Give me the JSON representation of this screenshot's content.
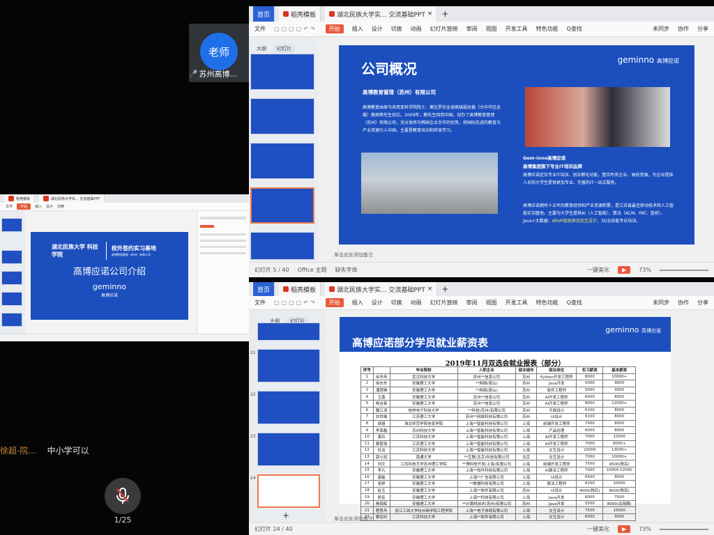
{
  "teacher": {
    "avatar_label": "老师",
    "name": "苏州高博..."
  },
  "chat": {
    "user": "徐超-院...",
    "message": "中小学可以"
  },
  "mic": {
    "counter": "1/25"
  },
  "tabs": {
    "home": "首页",
    "template": "稻壳模板",
    "doc": "湖北民族大学实... 交流基础PPT"
  },
  "menu": {
    "file": "文件",
    "start": "开始",
    "insert": "插入",
    "design": "设计",
    "switch": "切换",
    "anim": "动画",
    "show": "幻灯片放映",
    "review": "审阅",
    "view": "视图",
    "dev": "开发工具",
    "special": "特色功能",
    "search": "Q查找",
    "sync": "未同步",
    "collab": "协作",
    "share": "分享"
  },
  "toggle": {
    "outline": "大纲",
    "slides": "幻灯片"
  },
  "slide1": {
    "title": "公司概况",
    "company": "高博教育管理（苏州）有限公司",
    "brand": "geminno",
    "brand_cn": "高博应诺",
    "para1": "高博教育由原马来西亚科学院院士、莫比罗拉全球高级副总裁（大中华区总裁）赖炳荣先生创立。2009年，赖先生回到中国，创办了高博教育管理（苏州）有限公司，充分发挥与韩国企业合作的优势，将国际先进的教育与产业资源引入中国，主要是教育培训和终身学习。",
    "sub1": "Gem-inno高博应诺",
    "sub2": "高博集团旗下专业IT培训品牌",
    "para2": "高博应诺定位专业IT培训、创业孵化功能，整合所有企业、高校资源，为企业提供人员和大学生提供更加专业、完善的IT一站式服务。",
    "para3a": "高博应诺拥有十五年的教育经验和产业资源积累，是江苏省最佳移动技术和人工智能实训基地。主要为大学生提供AI（人工智能）、算法（ACM、PAT、蓝桥）、Java+大数据、",
    "para3b": "ARVR智能移动交互设计",
    "para3c": "、3D全技能专业培训。"
  },
  "status1": {
    "page": "幻灯片 5 / 40",
    "theme": "Office 主题",
    "font": "缺失字体",
    "notes": "单击此处添加备注",
    "beautify": "一键美化",
    "zoom": "73%"
  },
  "slide3": {
    "title": "高博应诺部分学员就业薪资表",
    "brand": "geminno",
    "brand_cn": "高博应诺",
    "table_title": "2019年11月双选会就业报表（部分）",
    "headers": [
      "序号",
      "毕业院校",
      "入职企业",
      "就业城市",
      "就业岗位",
      "实习薪资",
      "基本薪资"
    ],
    "rows": [
      [
        "1",
        "余东冉",
        "武汉科技大学",
        "苏州**信息公司",
        "苏州",
        "Python开发工程师",
        "8000",
        "10000+"
      ],
      [
        "2",
        "徐东东",
        "安徽理工大学",
        "**网络(昆山)",
        "苏州",
        "Java开发",
        "5000",
        "9000"
      ],
      [
        "3",
        "潘慧琳",
        "安徽理工大学",
        "**网络(昆山)",
        "苏州",
        "软件工程师",
        "5000",
        "9000"
      ],
      [
        "4",
        "王鑫",
        "安徽理工大学",
        "苏州**信息公司",
        "苏州",
        "AI开发工程师",
        "6000",
        "8000"
      ],
      [
        "5",
        "杨吉森",
        "安徽理工大学",
        "苏州**信息公司",
        "苏州",
        "AI开发工程师",
        "8000",
        "12000+"
      ],
      [
        "6",
        "魏江涛",
        "桂林电子科技大学",
        "**科技(苏州)有限公司",
        "苏州",
        "平面设计",
        "6100",
        "8000"
      ],
      [
        "7",
        "刘世雄",
        "江苏理工大学",
        "苏州**网络科技有限公司",
        "苏州",
        "UI设计",
        "6100",
        "8000"
      ],
      [
        "8",
        "胡瑾",
        "淮北师范学院信息学院",
        "上海**智能科技有限公司",
        "上海",
        "前端开发工程师",
        "7000",
        "8000"
      ],
      [
        "9",
        "李荣磊",
        "苏州科技大学",
        "上海**智能科技有限公司",
        "上海",
        "产品经理",
        "6000",
        "8000"
      ],
      [
        "10",
        "黄玲",
        "江苏科技大学",
        "上海**智能科技有限公司",
        "上海",
        "AI开发工程师",
        "7000",
        "12000"
      ],
      [
        "11",
        "蔡智强",
        "江苏理工大学",
        "上海**智能科技有限公司",
        "上海",
        "AI开发工程师",
        "7000",
        "9000+"
      ],
      [
        "12",
        "杜洁",
        "江苏科技大学",
        "上海**智能科技有限公司",
        "上海",
        "交互设计",
        "10000",
        "13000+"
      ],
      [
        "13",
        "郭小双",
        "南通大学",
        "**互联(北京)科技有限公司",
        "北京",
        "交互设计",
        "7000",
        "10000+"
      ],
      [
        "14",
        "刘文",
        "江苏科技大学苏州理工学院",
        "**博科技开发(上海)有限公司",
        "上海",
        "前端开发工程师",
        "7500",
        "9500(税后)"
      ],
      [
        "15",
        "李凡",
        "安徽理工大学",
        "上海**软件科技有限公司",
        "上海",
        "AI算法工程师",
        "7000",
        "10000-12000"
      ],
      [
        "16",
        "康能",
        "安徽理工大学",
        "上海**广告有限公司",
        "上海",
        "UI设计",
        "6500",
        "8500"
      ],
      [
        "17",
        "张婷",
        "安徽理工大学",
        "**数据科技有限公司",
        "上海",
        "算法工程师",
        "6100",
        "10000"
      ],
      [
        "18",
        "赵玉",
        "安徽理工大学",
        "上海**软件有限公司",
        "苏州",
        "UI设计",
        "4000(税后)",
        "8000(税后)"
      ],
      [
        "19",
        "段佳",
        "安徽理工大学",
        "上海**科技有限公司",
        "上海",
        "Java开发",
        "6000",
        "7500"
      ],
      [
        "20",
        "杨雨辉",
        "安徽理工大学",
        "**计算机技术(苏州)有限公司",
        "苏州",
        "Java开发",
        "5500",
        "8000(试用期)"
      ],
      [
        "21",
        "程思舟",
        "浙江工商大学杭州商学院工程学院",
        "上海**电子游戏有限公司",
        "上海",
        "交互设计",
        "7500",
        "10000"
      ],
      [
        "22",
        "蔡佳欣",
        "江苏科技大学",
        "上海**软件有限公司",
        "上海",
        "交互设计",
        "6000",
        "9000"
      ]
    ]
  },
  "status3": {
    "page": "幻灯片 24 / 40",
    "notes": "单击此处添加备注",
    "beautify": "一键美化",
    "zoom": "73%"
  },
  "slide2": {
    "school": "湖北民族大学 科技学院",
    "base": "校外签约实习基地",
    "base_sub": "高博教育管理（苏州）有限公司",
    "title": "高博应诺公司介绍",
    "brand": "geminno",
    "brand_cn": "高博应诺"
  },
  "thumb_numbers": [
    "21",
    "22",
    "23",
    "24"
  ],
  "colors": {
    "slide_blue": "#1c4fbd",
    "accent_red": "#e9593c",
    "avatar_blue": "#1e6fe8"
  }
}
